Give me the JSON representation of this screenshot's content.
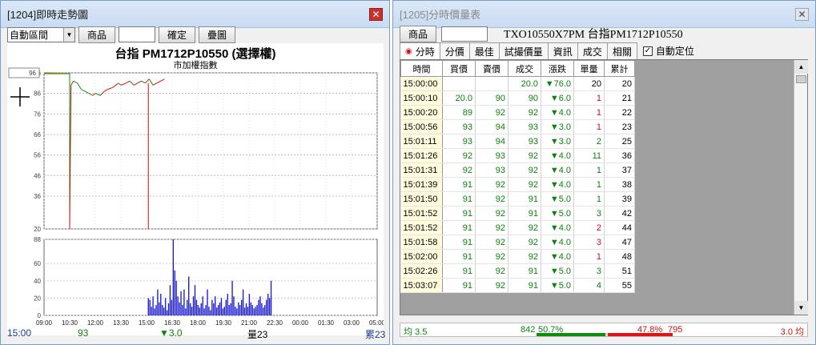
{
  "left": {
    "title": "[1204]即時走勢圖",
    "range_select": "自動區間",
    "product_btn": "商品",
    "confirm_btn": "確定",
    "overlay_btn": "疊圖",
    "chart_title": "台指 PM1712P10550 (選擇權)",
    "chart_subtitle": "市加權指數",
    "price_box": "96",
    "status_time": "15:00",
    "status_price": "93",
    "status_change": "▼3.0",
    "status_volume": "量23",
    "status_total": "累23"
  },
  "right": {
    "title": "[1205]分時價量表",
    "product_btn": "商品",
    "symbol_title": "TXO10550X7PM 台指PM1712P10550",
    "tabs": [
      "分時",
      "分價",
      "最佳",
      "試撮價量",
      "資訊",
      "成交",
      "相關"
    ],
    "auto_locate": "自動定位",
    "headers": [
      "時間",
      "買價",
      "賣價",
      "成交",
      "漲跌",
      "單量",
      "累計"
    ],
    "rows": [
      [
        "15:00:00",
        "",
        "",
        "20.0",
        "▼76.0",
        "20",
        "20"
      ],
      [
        "15:00:10",
        "20.0",
        "90",
        "90",
        "▼6.0",
        "1",
        "21"
      ],
      [
        "15:00:20",
        "89",
        "92",
        "92",
        "▼4.0",
        "1",
        "22"
      ],
      [
        "15:00:56",
        "93",
        "94",
        "93",
        "▼3.0",
        "1",
        "23"
      ],
      [
        "15:01:11",
        "93",
        "94",
        "93",
        "▼3.0",
        "2",
        "25"
      ],
      [
        "15:01:26",
        "92",
        "93",
        "92",
        "▼4.0",
        "11",
        "36"
      ],
      [
        "15:01:31",
        "92",
        "93",
        "92",
        "▼4.0",
        "1",
        "37"
      ],
      [
        "15:01:39",
        "91",
        "92",
        "92",
        "▼4.0",
        "1",
        "38"
      ],
      [
        "15:01:50",
        "91",
        "92",
        "91",
        "▼5.0",
        "1",
        "39"
      ],
      [
        "15:01:52",
        "91",
        "92",
        "91",
        "▼5.0",
        "3",
        "42"
      ],
      [
        "15:01:52",
        "91",
        "92",
        "92",
        "▼4.0",
        "2",
        "44"
      ],
      [
        "15:01:58",
        "91",
        "92",
        "92",
        "▼4.0",
        "3",
        "47"
      ],
      [
        "15:02:00",
        "91",
        "92",
        "92",
        "▼4.0",
        "1",
        "48"
      ],
      [
        "15:02:26",
        "91",
        "92",
        "91",
        "▼5.0",
        "3",
        "51"
      ],
      [
        "15:03:07",
        "91",
        "92",
        "91",
        "▼5.0",
        "4",
        "55"
      ]
    ],
    "row_colors": [
      [
        "k",
        "k",
        "k",
        "g",
        "g",
        "k",
        "k"
      ],
      [
        "k",
        "g",
        "g",
        "g",
        "g",
        "r",
        "k"
      ],
      [
        "k",
        "g",
        "g",
        "g",
        "g",
        "r",
        "k"
      ],
      [
        "k",
        "g",
        "g",
        "g",
        "g",
        "r",
        "k"
      ],
      [
        "k",
        "g",
        "g",
        "g",
        "g",
        "g",
        "k"
      ],
      [
        "k",
        "g",
        "g",
        "g",
        "g",
        "g",
        "k"
      ],
      [
        "k",
        "g",
        "g",
        "g",
        "g",
        "g",
        "k"
      ],
      [
        "k",
        "g",
        "g",
        "g",
        "g",
        "g",
        "k"
      ],
      [
        "k",
        "g",
        "g",
        "g",
        "g",
        "g",
        "k"
      ],
      [
        "k",
        "g",
        "g",
        "g",
        "g",
        "g",
        "k"
      ],
      [
        "k",
        "g",
        "g",
        "g",
        "g",
        "r",
        "k"
      ],
      [
        "k",
        "g",
        "g",
        "g",
        "g",
        "r",
        "k"
      ],
      [
        "k",
        "g",
        "g",
        "g",
        "g",
        "r",
        "k"
      ],
      [
        "k",
        "g",
        "g",
        "g",
        "g",
        "g",
        "k"
      ],
      [
        "k",
        "g",
        "g",
        "g",
        "g",
        "g",
        "k"
      ]
    ],
    "bottom": {
      "avg_left": "均 3.5",
      "buy_count": "842",
      "buy_pct": "50.7%",
      "sell_pct": "47.8%",
      "sell_count": "795",
      "avg_right": "3.0 均",
      "buy_frac": 0.507,
      "sell_frac": 0.478
    }
  },
  "chart_data": {
    "type": "line",
    "x_ticks": [
      "09:00",
      "10:30",
      "12:00",
      "13:30",
      "15:00",
      "16:30",
      "18:00",
      "19:30",
      "21:00",
      "22:30",
      "00:00",
      "01:30",
      "03:00",
      "05:00"
    ],
    "y_ticks": [
      20.0,
      36.0,
      46.0,
      56,
      66,
      76,
      86,
      96
    ],
    "ylim": [
      20,
      96
    ],
    "reference_price": 96,
    "series": [
      {
        "x": [
          0,
          0.15,
          0.95,
          1.0,
          1.0,
          1.05,
          1.15,
          1.3,
          1.45,
          1.6,
          1.75,
          1.9,
          2.0,
          2.2,
          2.35,
          2.5,
          2.7,
          2.9,
          3.0,
          3.2,
          3.35,
          3.5,
          3.65,
          3.8,
          3.95,
          4.1,
          4.25,
          4.4,
          4.55,
          4.7
        ],
        "y": [
          96,
          96,
          95.5,
          96,
          20,
          90,
          92,
          91,
          88,
          87,
          86,
          85,
          86,
          85,
          87,
          88,
          89,
          91,
          90,
          91,
          92,
          90,
          91,
          92,
          91,
          93,
          90,
          91,
          92,
          93
        ]
      }
    ],
    "volume": {
      "ylim": [
        0,
        88
      ],
      "y_ticks": [
        0,
        20,
        40,
        60,
        88
      ],
      "bars": [
        20,
        18,
        10,
        22,
        8,
        12,
        30,
        15,
        25,
        12,
        9,
        20,
        6,
        14,
        35,
        18,
        88,
        52,
        40,
        22,
        15,
        28,
        12,
        30,
        8,
        18,
        45,
        14,
        10,
        22,
        35,
        18,
        12,
        9,
        14,
        22,
        8,
        12,
        30,
        10,
        6,
        18,
        14,
        22,
        9,
        12,
        15,
        20,
        8,
        10,
        18,
        25,
        12,
        14,
        40,
        22,
        10,
        8,
        15,
        12,
        18,
        30,
        9,
        14,
        10,
        25,
        15,
        12,
        8,
        10,
        12,
        18,
        22,
        14,
        9,
        12,
        18,
        25,
        20,
        40
      ]
    }
  }
}
